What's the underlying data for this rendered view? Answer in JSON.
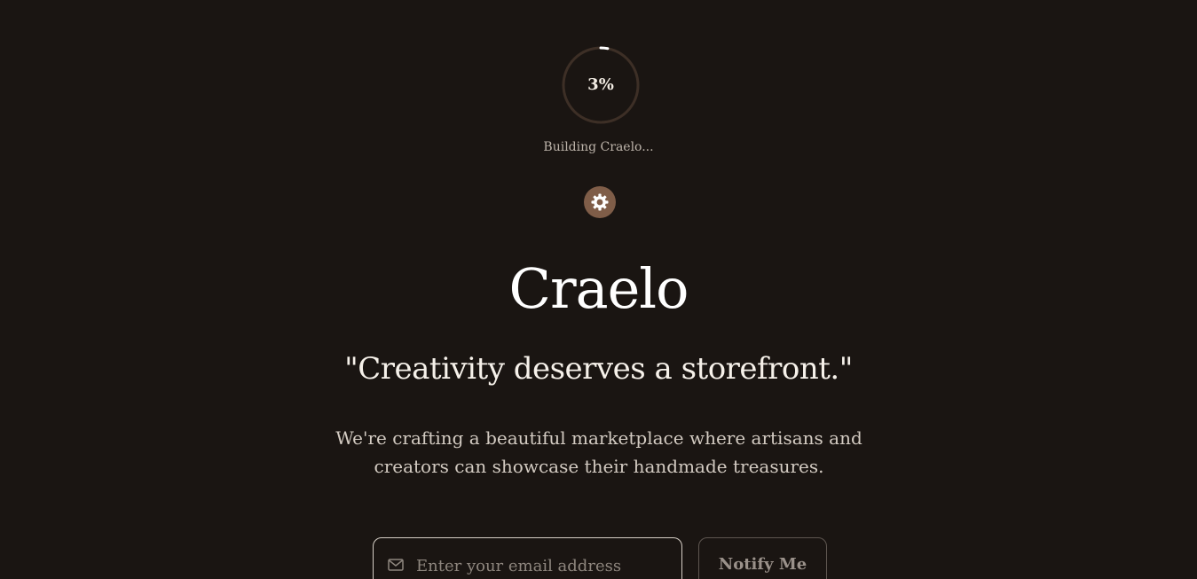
{
  "loader": {
    "progress_percent": 3,
    "progress_label": "3%",
    "status_text": "Building Craelo..."
  },
  "icons": {
    "loader_badge": "gear-icon",
    "email": "mail-icon"
  },
  "hero": {
    "brand_name": "Craelo",
    "tagline": "\"Creativity deserves a storefront.\"",
    "description": "We're crafting a beautiful marketplace where artisans and creators can showcase their handmade treasures."
  },
  "signup": {
    "email_placeholder": "Enter your email address",
    "email_value": "",
    "notify_label": "Notify Me"
  },
  "colors": {
    "background": "#1a1512",
    "accent_brown": "#7f5d48",
    "progress_track": "#3d2f26",
    "progress_fill": "#ffffff"
  }
}
